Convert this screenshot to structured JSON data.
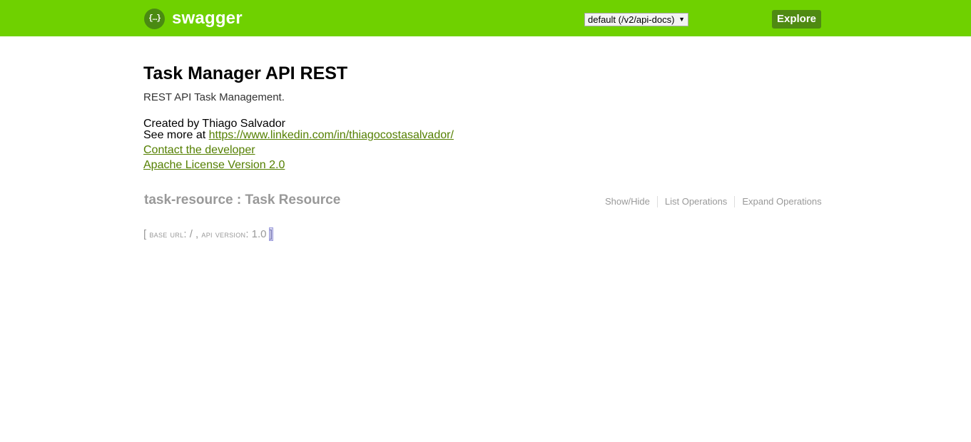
{
  "header": {
    "logo_glyph": "{…}",
    "logo_text": "swagger",
    "spec_select_value": "default (/v2/api-docs)",
    "explore_label": "Explore",
    "brand_color": "#6fd100",
    "explore_color": "#4f8a12"
  },
  "info": {
    "title": "Task Manager API REST",
    "description": "REST API Task Management.",
    "created_by": "Created by Thiago Salvador",
    "see_more_prefix": "See more at ",
    "see_more_link": "https://www.linkedin.com/in/thiagocostasalvador/",
    "contact_link": "Contact the developer",
    "license_link": "Apache License Version 2.0",
    "link_color": "#547f00"
  },
  "resource": {
    "heading": "task-resource : Task Resource",
    "ops": [
      "Show/Hide",
      "List Operations",
      "Expand Operations"
    ]
  },
  "footer": {
    "open_bracket": "[",
    "base_url_label": "base url",
    "base_url_value": ": / , ",
    "api_version_label": "api version",
    "api_version_value": ": 1.0 ",
    "close_bracket": "]"
  }
}
